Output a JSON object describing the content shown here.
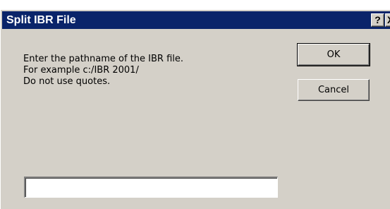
{
  "window": {
    "title": "Split IBR File",
    "help_label": "?",
    "close_label": "X"
  },
  "prompt": {
    "line1": "Enter the pathname of the IBR file.",
    "line2": "For example c:/IBR 2001/",
    "line3": "Do not use quotes."
  },
  "buttons": {
    "ok_label": "OK",
    "cancel_label": "Cancel"
  },
  "path_input": {
    "value": "",
    "placeholder": ""
  },
  "colors": {
    "titlebar": "#0a246a",
    "dialog_face": "#d4d0c8"
  }
}
